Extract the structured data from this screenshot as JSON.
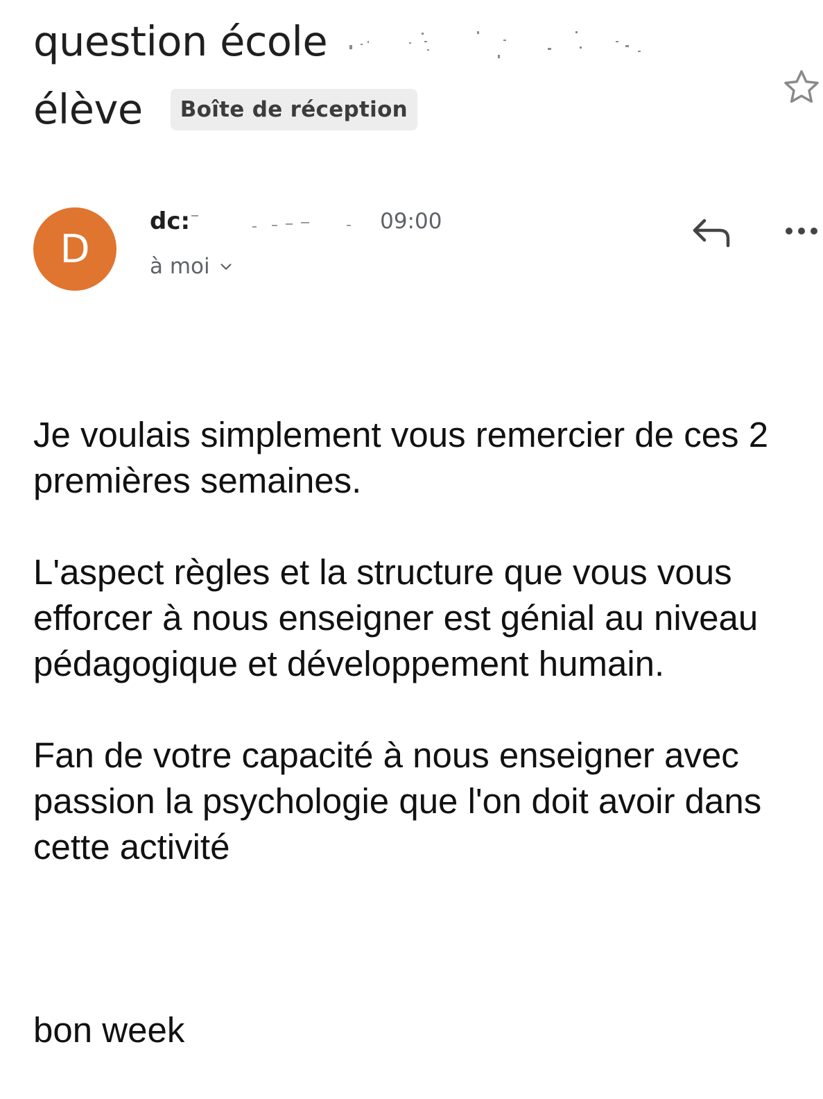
{
  "message": {
    "subject_line1": "question école",
    "subject_line2": "élève",
    "label": "Boîte de réception",
    "sender_prefix": "dc:",
    "time": "09:00",
    "recipient": "à moi",
    "avatar_letter": "D",
    "avatar_color": "#e07530",
    "body_paragraph_1": "Je voulais simplement vous remercier de ces 2 premières semaines.",
    "body_paragraph_2": "L'aspect règles et la structure que vous vous efforcer à nous enseigner est génial au niveau pédagogique et développement humain.",
    "body_paragraph_3": "Fan de votre capacité à nous enseigner avec passion la psychologie que l'on doit avoir dans cette activité",
    "signoff": "bon week"
  },
  "icons": {
    "star": "star-outline-icon",
    "reply": "reply-arrow-icon",
    "more": "more-horizontal-icon",
    "chevron": "chevron-down-icon"
  }
}
